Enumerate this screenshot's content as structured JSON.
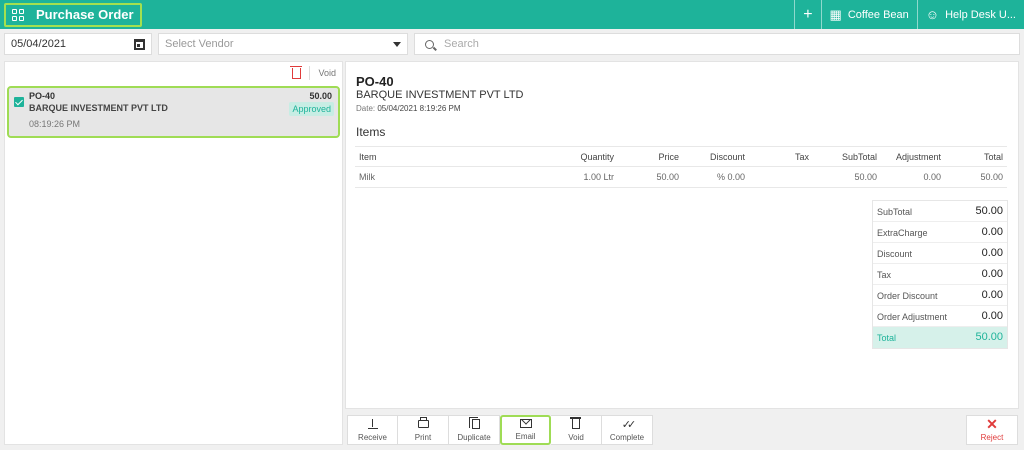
{
  "header": {
    "title": "Purchase Order",
    "title_icon": "grid-icon",
    "add_label": "+",
    "store_name": "Coffee Bean",
    "user_name": "Help Desk U..."
  },
  "filters": {
    "date_value": "05/04/2021",
    "vendor_placeholder": "Select Vendor",
    "search_placeholder": "Search"
  },
  "list": {
    "void_label": "Void",
    "orders": [
      {
        "id": "PO-40",
        "vendor": "BARQUE INVESTMENT PVT LTD",
        "time": "08:19:26 PM",
        "amount": "50.00",
        "status": "Approved"
      }
    ]
  },
  "detail": {
    "po_id": "PO-40",
    "vendor": "BARQUE INVESTMENT PVT LTD",
    "date_label": "Date:",
    "date_value": "05/04/2021 8:19:26 PM",
    "items_heading": "Items",
    "columns": {
      "item": "Item",
      "quantity": "Quantity",
      "price": "Price",
      "discount": "Discount",
      "tax": "Tax",
      "subtotal": "SubTotal",
      "adjustment": "Adjustment",
      "total": "Total"
    },
    "rows": [
      {
        "item": "Milk",
        "quantity": "1.00 Ltr",
        "price": "50.00",
        "discount": "% 0.00",
        "tax": "",
        "subtotal": "50.00",
        "adjustment": "0.00",
        "total": "50.00"
      }
    ],
    "totals": [
      {
        "label": "SubTotal",
        "value": "50.00"
      },
      {
        "label": "ExtraCharge",
        "value": "0.00"
      },
      {
        "label": "Discount",
        "value": "0.00"
      },
      {
        "label": "Tax",
        "value": "0.00"
      },
      {
        "label": "Order Discount",
        "value": "0.00"
      },
      {
        "label": "Order Adjustment",
        "value": "0.00"
      },
      {
        "label": "Total",
        "value": "50.00"
      }
    ]
  },
  "actions": {
    "receive": "Receive",
    "print": "Print",
    "duplicate": "Duplicate",
    "email": "Email",
    "void": "Void",
    "complete": "Complete",
    "reject": "Reject"
  },
  "colors": {
    "brand": "#1eb39a",
    "highlight": "#9fdc55",
    "danger": "#e03b3b"
  }
}
